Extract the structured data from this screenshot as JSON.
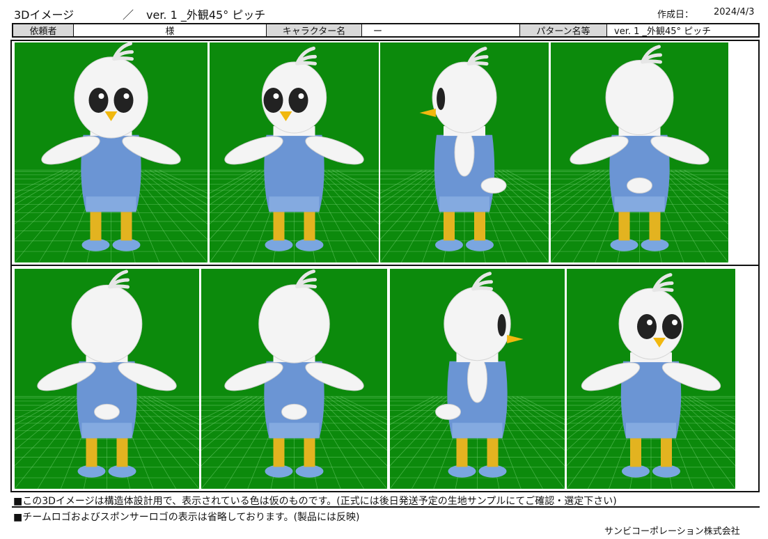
{
  "header": {
    "title": "3Dイメージ",
    "slash": "／",
    "version_title": "ver. 1 _外観45° ピッチ",
    "date_label": "作成日：",
    "date_value": "2024/4/3"
  },
  "info": {
    "client_label": "依頼者",
    "client_value": "様",
    "character_label": "キャラクター名",
    "character_value": "ー",
    "pattern_label": "パターン名等",
    "pattern_value": "ver. 1 _外観45° ピッチ"
  },
  "views": [
    {
      "angle": "front"
    },
    {
      "angle": "front-left-45"
    },
    {
      "angle": "side-left"
    },
    {
      "angle": "back-left-45"
    },
    {
      "angle": "back"
    },
    {
      "angle": "back-right-45"
    },
    {
      "angle": "side-right"
    },
    {
      "angle": "front-right-45"
    }
  ],
  "notes": {
    "line1": "■この3Dイメージは構造体設計用で、表示されている色は仮のものです。(正式には後日発送予定の生地サンプルにてご確認・選定下さい)",
    "line2": "■チームロゴおよびスポンサーロゴの表示は省略しております。(製品には反映)"
  },
  "footer": {
    "company": "サンビコーポレーション株式会社"
  },
  "colors": {
    "background_green": "#0c8a0c",
    "body_blue": "#6b95d4",
    "beak_yellow": "#f1b80f",
    "leg_yellow": "#e3b320",
    "white": "#f4f4f4"
  }
}
